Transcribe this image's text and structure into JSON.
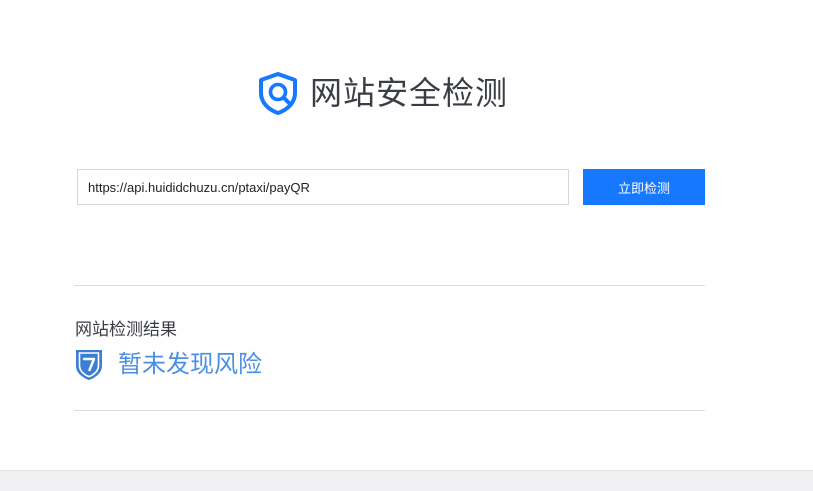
{
  "header": {
    "title": "网站安全检测",
    "logo_icon": "shield-search-icon"
  },
  "search": {
    "url_value": "https://api.huididchuzu.cn/ptaxi/payQR",
    "button_label": "立即检测"
  },
  "result": {
    "heading": "网站检测结果",
    "status_icon": "shield-check-icon",
    "status_text": "暂未发现风险"
  },
  "colors": {
    "accent": "#1677ff",
    "result_text": "#4a8fe6",
    "title_text": "#3a3d44"
  }
}
